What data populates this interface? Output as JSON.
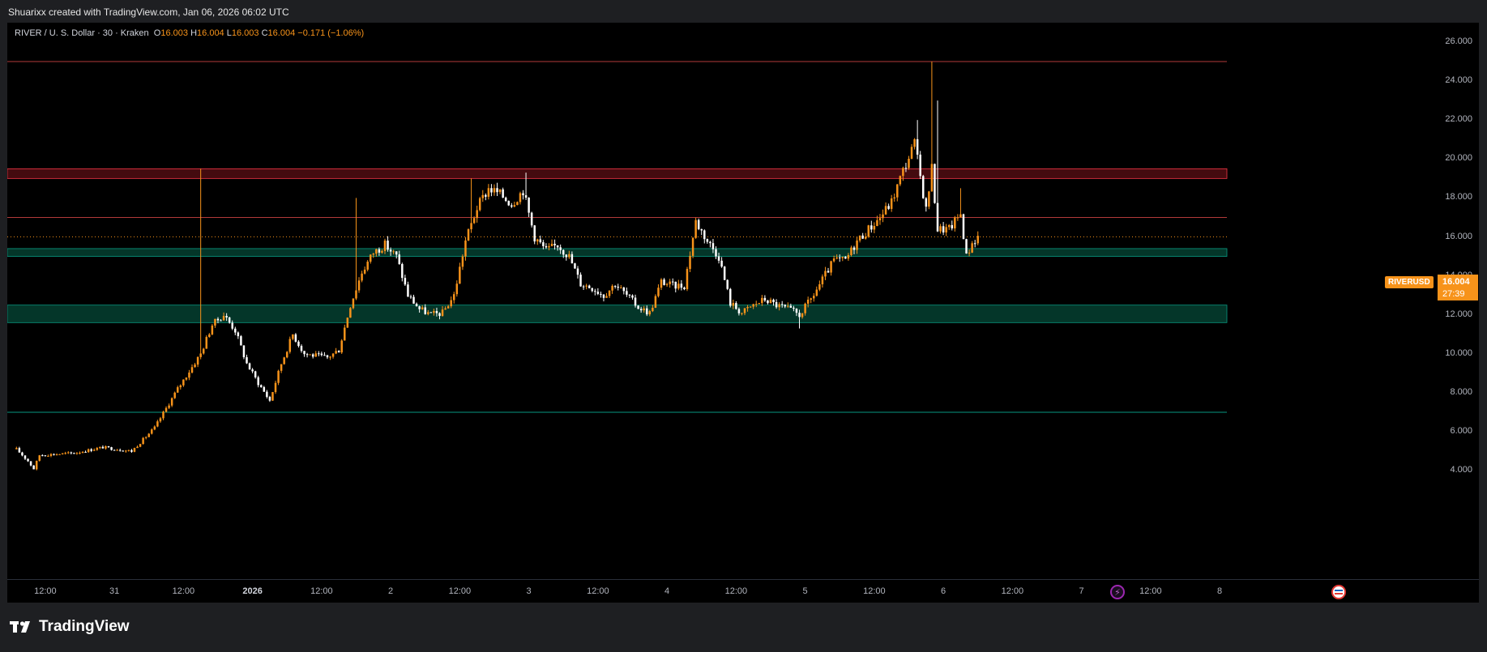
{
  "attribution": "Shuarixx created with TradingView.com, Jan 06, 2026 06:02 UTC",
  "legend": {
    "symbol_text": "RIVER / U. S. Dollar · 30 · Kraken",
    "o_label": "O",
    "o_value": "16.003",
    "h_label": "H",
    "h_value": "16.004",
    "l_label": "L",
    "l_value": "16.003",
    "c_label": "C",
    "c_value": "16.004",
    "change": "−0.171 (−1.06%)"
  },
  "price_tag": {
    "symbol": "RIVERUSD",
    "price": "16.004",
    "countdown": "27:39"
  },
  "brand": "TradingView",
  "colors": {
    "up": "#f7931a",
    "down": "#ffffff",
    "resistance": "#f23645",
    "support": "#089981",
    "accent": "#f7931a"
  },
  "icons": [
    "bolt-icon",
    "us-flag-icon",
    "tradingview-logo-icon"
  ],
  "chart_data": {
    "type": "candlestick",
    "ylim": [
      3.0,
      27.0
    ],
    "y_ticks": [
      "4.000",
      "6.000",
      "8.000",
      "10.000",
      "12.000",
      "14.000",
      "16.000",
      "18.000",
      "20.000",
      "22.000",
      "24.000",
      "26.000"
    ],
    "x_ticks": [
      {
        "label": "12:00",
        "i": 10
      },
      {
        "label": "31",
        "i": 34
      },
      {
        "label": "12:00",
        "i": 58
      },
      {
        "label": "2026",
        "i": 82,
        "bold": true
      },
      {
        "label": "12:00",
        "i": 106
      },
      {
        "label": "2",
        "i": 130
      },
      {
        "label": "12:00",
        "i": 154
      },
      {
        "label": "3",
        "i": 178
      },
      {
        "label": "12:00",
        "i": 202
      },
      {
        "label": "4",
        "i": 226
      },
      {
        "label": "12:00",
        "i": 250
      },
      {
        "label": "5",
        "i": 274
      },
      {
        "label": "12:00",
        "i": 298
      },
      {
        "label": "6",
        "i": 322
      },
      {
        "label": "12:00",
        "i": 346
      },
      {
        "label": "7",
        "i": 370
      },
      {
        "label": "12:00",
        "i": 394
      },
      {
        "label": "8",
        "i": 418
      }
    ],
    "x_range": [
      -1.5,
      420.5
    ],
    "last_price": 16.004,
    "horizontal_lines": [
      {
        "y": 25.0,
        "kind": "resistance"
      },
      {
        "y": 17.0,
        "kind": "resistance"
      },
      {
        "y": 7.0,
        "kind": "support"
      }
    ],
    "zones": [
      {
        "y1": 19.0,
        "y2": 19.5,
        "kind": "resistance"
      },
      {
        "y1": 15.0,
        "y2": 15.4,
        "kind": "support"
      },
      {
        "y1": 11.6,
        "y2": 12.5,
        "kind": "support"
      }
    ],
    "key_points": [
      [
        0,
        5.1
      ],
      [
        4,
        4.5
      ],
      [
        6,
        4.1
      ],
      [
        8,
        4.8
      ],
      [
        20,
        4.9
      ],
      [
        30,
        5.2
      ],
      [
        40,
        5.0
      ],
      [
        48,
        6.2
      ],
      [
        56,
        8.2
      ],
      [
        64,
        10.0
      ],
      [
        68,
        11.5
      ],
      [
        72,
        12.0
      ],
      [
        76,
        11.2
      ],
      [
        80,
        9.5
      ],
      [
        84,
        8.5
      ],
      [
        88,
        7.6
      ],
      [
        92,
        9.5
      ],
      [
        96,
        11.0
      ],
      [
        100,
        10.0
      ],
      [
        108,
        9.8
      ],
      [
        112,
        10.2
      ],
      [
        116,
        12.5
      ],
      [
        120,
        14.2
      ],
      [
        124,
        15.2
      ],
      [
        128,
        15.6
      ],
      [
        132,
        15.0
      ],
      [
        136,
        13.0
      ],
      [
        140,
        12.3
      ],
      [
        144,
        12.0
      ],
      [
        148,
        12.1
      ],
      [
        152,
        13.0
      ],
      [
        156,
        15.8
      ],
      [
        160,
        17.5
      ],
      [
        164,
        18.5
      ],
      [
        168,
        18.2
      ],
      [
        172,
        17.7
      ],
      [
        176,
        18.4
      ],
      [
        180,
        16.0
      ],
      [
        184,
        15.3
      ],
      [
        188,
        15.6
      ],
      [
        192,
        15.0
      ],
      [
        196,
        13.6
      ],
      [
        200,
        13.4
      ],
      [
        204,
        13.0
      ],
      [
        208,
        13.6
      ],
      [
        212,
        13.0
      ],
      [
        216,
        12.4
      ],
      [
        220,
        12.1
      ],
      [
        224,
        13.7
      ],
      [
        228,
        13.5
      ],
      [
        232,
        13.5
      ],
      [
        236,
        16.8
      ],
      [
        240,
        15.8
      ],
      [
        244,
        15.0
      ],
      [
        248,
        12.6
      ],
      [
        252,
        12.1
      ],
      [
        256,
        12.5
      ],
      [
        260,
        12.8
      ],
      [
        264,
        12.5
      ],
      [
        268,
        12.3
      ],
      [
        272,
        12.0
      ],
      [
        276,
        12.8
      ],
      [
        280,
        13.8
      ],
      [
        284,
        14.8
      ],
      [
        288,
        14.8
      ],
      [
        292,
        15.8
      ],
      [
        296,
        16.4
      ],
      [
        300,
        17.0
      ],
      [
        304,
        17.8
      ],
      [
        308,
        19.4
      ],
      [
        312,
        20.8
      ],
      [
        316,
        17.4
      ],
      [
        318,
        19.5
      ],
      [
        320,
        16.4
      ],
      [
        324,
        16.4
      ],
      [
        328,
        17.2
      ],
      [
        330,
        15.0
      ],
      [
        332,
        15.7
      ],
      [
        334,
        16.0
      ]
    ],
    "spikes": [
      {
        "i": 64,
        "high": 19.5
      },
      {
        "i": 118,
        "high": 18.0
      },
      {
        "i": 158,
        "high": 19.0
      },
      {
        "i": 177,
        "high": 19.3
      },
      {
        "i": 272,
        "high": 11.3
      },
      {
        "i": 313,
        "high": 22.0
      },
      {
        "i": 318,
        "high": 25.0
      },
      {
        "i": 320,
        "high": 23.0
      },
      {
        "i": 328,
        "high": 18.5
      }
    ]
  }
}
